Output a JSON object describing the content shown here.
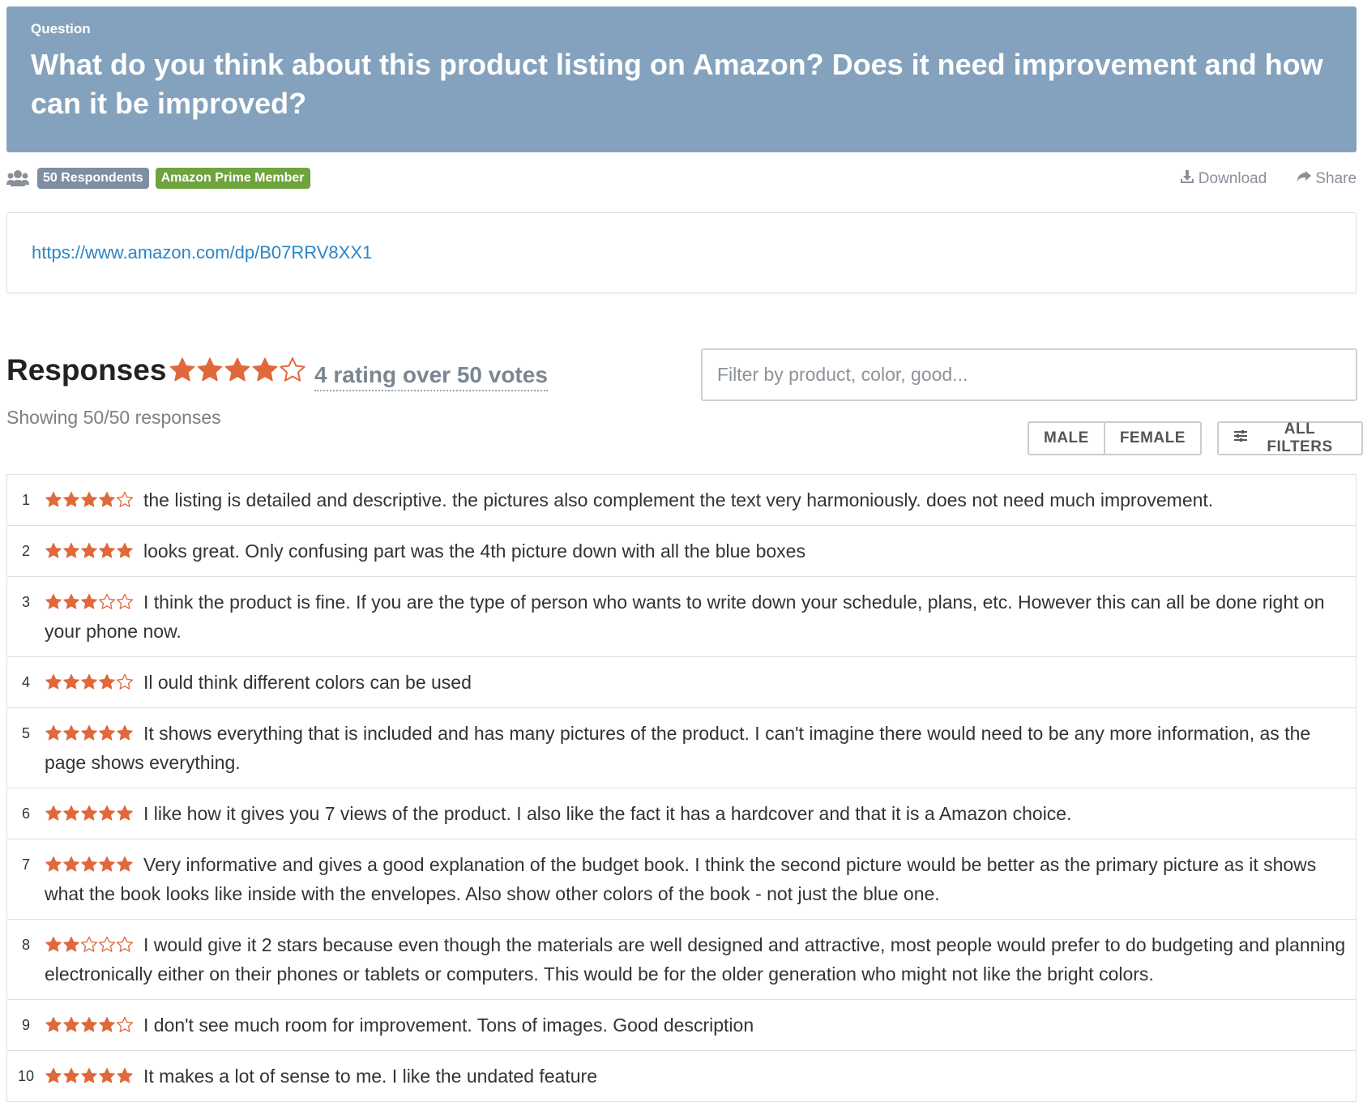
{
  "header": {
    "kicker": "Question",
    "question": "What do you think about this product listing on Amazon? Does it need improvement and how can it be improved?"
  },
  "meta": {
    "respondents_badge": "50 Respondents",
    "segment_badge": "Amazon Prime Member",
    "download_label": "Download",
    "share_label": "Share"
  },
  "link": {
    "url": "https://www.amazon.com/dp/B07RRV8XX1"
  },
  "responses": {
    "title": "Responses",
    "overall_stars": 4,
    "rating_text": "4 rating over 50 votes",
    "showing": "Showing 50/50 responses",
    "filter_placeholder": "Filter by product, color, good...",
    "gender_filters": [
      "MALE",
      "FEMALE"
    ],
    "all_filters_label": "ALL FILTERS"
  },
  "colors": {
    "banner": "#84a2bd",
    "star": "#e0683a",
    "link": "#2a86c8",
    "badge_gray": "#7f8fa1",
    "badge_green": "#6fa33d"
  },
  "rows": [
    {
      "n": "1",
      "stars": 4,
      "text": "the listing is detailed and descriptive. the pictures also complement the text very harmoniously. does not need much improvement."
    },
    {
      "n": "2",
      "stars": 5,
      "text": "looks great. Only confusing part was the 4th picture down with all the blue boxes"
    },
    {
      "n": "3",
      "stars": 3,
      "text": "I think the product is fine. If you are the type of person who wants to write down your schedule, plans, etc. However this can all be done right on your phone now."
    },
    {
      "n": "4",
      "stars": 4,
      "text": "Il ould think different colors can be used"
    },
    {
      "n": "5",
      "stars": 5,
      "text": "It shows everything that is included and has many pictures of the product. I can't imagine there would need to be any more information, as the page shows everything."
    },
    {
      "n": "6",
      "stars": 5,
      "text": "I like how it gives you 7 views of the product. I also like the fact it has a hardcover and that it is a Amazon choice."
    },
    {
      "n": "7",
      "stars": 5,
      "text": "Very informative and gives a good explanation of the budget book. I think the second picture would be better as the primary picture as it shows what the book looks like inside with the envelopes. Also show other colors of the book - not just the blue one."
    },
    {
      "n": "8",
      "stars": 2,
      "text": "I would give it 2 stars because even though the materials are well designed and attractive, most people would prefer to do budgeting and planning electronically either on their phones or tablets or computers. This would be for the older generation who might not like the bright colors."
    },
    {
      "n": "9",
      "stars": 4,
      "text": "I don't see much room for improvement. Tons of images. Good description"
    },
    {
      "n": "10",
      "stars": 5,
      "text": "It makes a lot of sense to me. I like the undated feature"
    }
  ]
}
